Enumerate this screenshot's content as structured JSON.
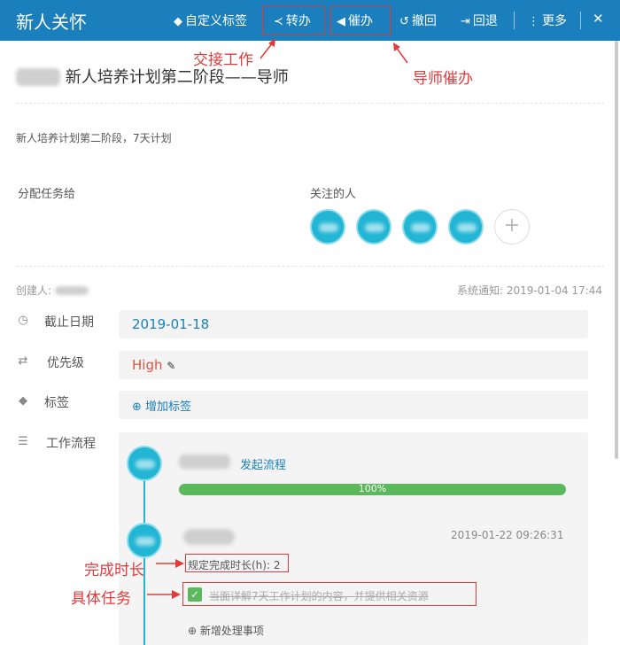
{
  "header": {
    "title": "新人关怀",
    "actions": {
      "custom_tag": "自定义标签",
      "transfer": "转办",
      "urge": "催办",
      "withdraw": "撤回",
      "send_back": "回退",
      "more": "更多",
      "close": "✕"
    }
  },
  "annotations": {
    "handover": "交接工作",
    "mentor_urge": "导师催办",
    "duration": "完成时长",
    "specific_task": "具体任务"
  },
  "task": {
    "title": "新人培养计划第二阶段——导师",
    "description": "新人培养计划第二阶段，7天计划",
    "assign_label": "分配任务给",
    "followers_label": "关注的人",
    "add_follower": "+",
    "creator_label": "创建人:",
    "system_notice": "系统通知: 2019-01-04 17:44"
  },
  "fields": {
    "deadline_label": "截止日期",
    "deadline_value": "2019-01-18",
    "priority_label": "优先级",
    "priority_value": "High",
    "tags_label": "标签",
    "tags_add": "⊕ 增加标签",
    "workflow_label": "工作流程"
  },
  "workflow": {
    "start_label": "发起流程",
    "progress_text": "100%",
    "progress_value": 1.0,
    "step_time": "2019-01-22 09:26:31",
    "duration_text": "规定完成时长(h): 2",
    "item_text": "当面详解7天工作计划的内容，并提供相关资源",
    "add_item": "⊕ 新增处理事项"
  },
  "colors": {
    "header_bg": "#1a7fbc",
    "annotation": "#e03b3b",
    "avatar": "#22b5d4",
    "progress": "#5cb85c",
    "priority": "#e0553f"
  }
}
